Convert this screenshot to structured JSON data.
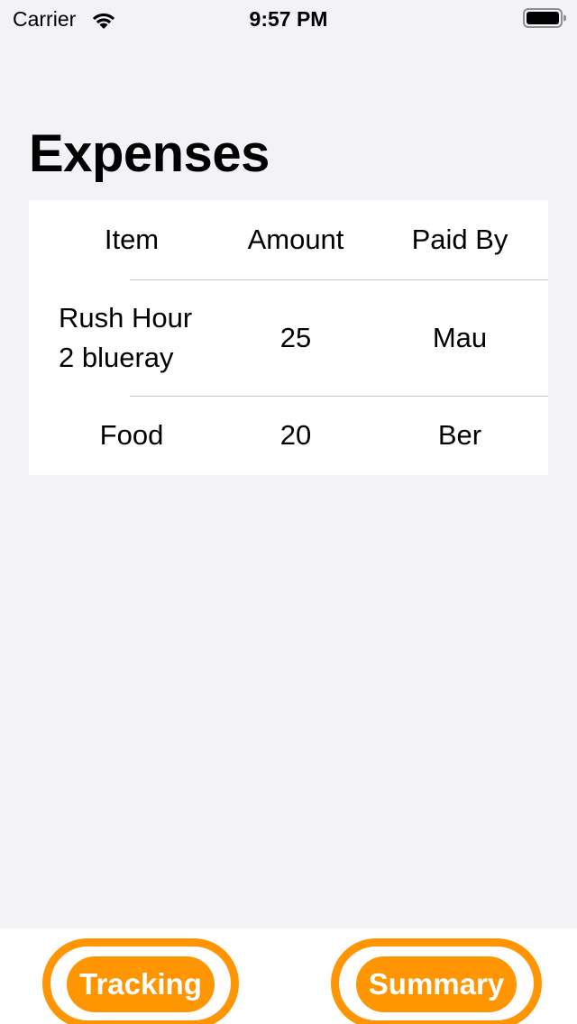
{
  "status_bar": {
    "carrier": "Carrier",
    "time": "9:57 PM",
    "wifi_icon": "wifi-icon",
    "battery_icon": "battery-icon"
  },
  "title": "Expenses",
  "table": {
    "headers": [
      "Item",
      "Amount",
      "Paid By"
    ],
    "rows": [
      [
        "Rush Hour 2 blueray",
        "25",
        "Mau"
      ],
      [
        "Food",
        "20",
        "Ber"
      ]
    ]
  },
  "bottom_bar": {
    "tracking_label": "Tracking",
    "summary_label": "Summary"
  },
  "colors": {
    "accent": "#ff9500",
    "background": "#f2f2f7",
    "card": "#ffffff",
    "divider": "#c6c6c8"
  }
}
